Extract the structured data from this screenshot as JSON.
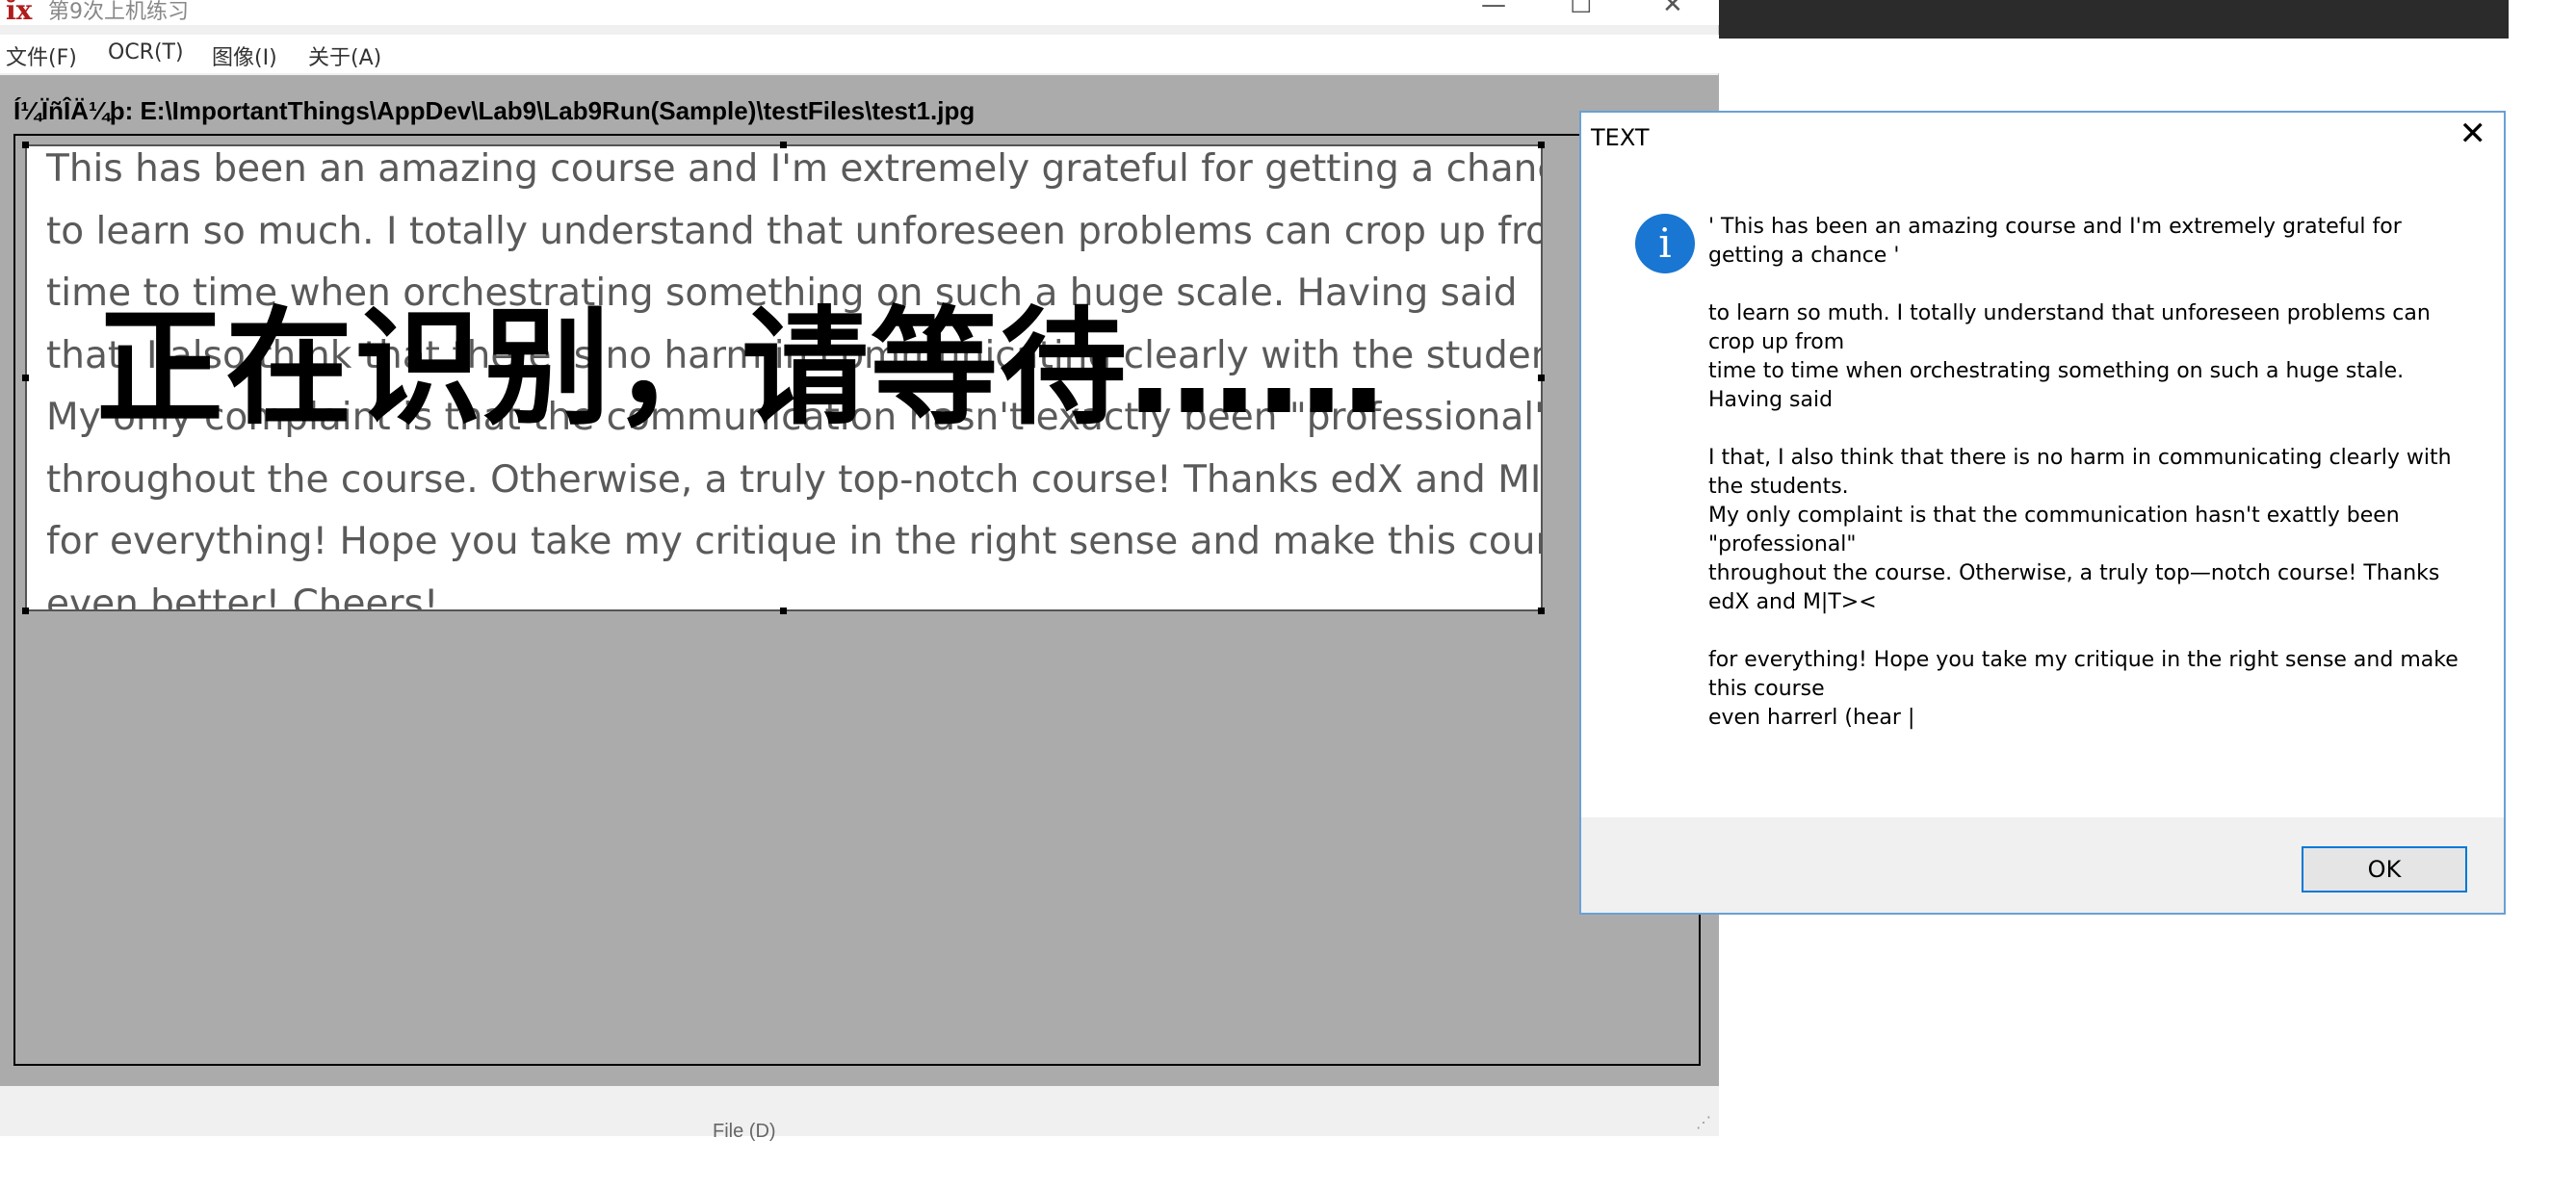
{
  "window": {
    "app_icon": "ĭx",
    "title": "第9次上机练习",
    "minimize": "—",
    "maximize": "☐",
    "close": "✕"
  },
  "menu": {
    "items": [
      "文件(F)",
      "OCR(T)",
      "图像(I)",
      "关于(A)"
    ]
  },
  "path_label": "Í¼ÏñÎÄ¼þ: E:\\ImportantThings\\AppDev\\Lab9\\Lab9Run(Sample)\\testFiles\\test1.jpg",
  "image_lines": [
    "This has been an amazing course and I'm extremely grateful for getting a chance",
    "to learn so much. I totally understand that unforeseen problems can crop up from",
    "time to time when orchestrating something on such a huge scale. Having said",
    "that, I also think that there is no harm in communicating clearly with the students.",
    "My only complaint is that the communication hasn't exactly been \"professional\"",
    "throughout the course. Otherwise, a truly top-notch course! Thanks edX and MITx",
    "for everything! Hope you take my critique in the right sense and make this course",
    "even better! Cheers!"
  ],
  "overlay_text": "正在识别，请等待……",
  "status_text": "File (D)",
  "dialog": {
    "title": "TEXT",
    "close": "✕",
    "icon": "info-icon",
    "lines": [
      "' This has been an amazing course and I'm extremely grateful for",
      "getting a chance '",
      "",
      "to learn so muth. I totally understand that unforeseen problems can",
      "crop up from",
      "time to time when orchestrating something on such a huge stale.",
      "Having said",
      "",
      "I that, I also think that there is no harm in communicating clearly with",
      "the students.",
      "My only complaint is that the communication hasn't exattly been",
      "\"professional\"",
      "throughout the course. Otherwise, a truly top—notch course! Thanks",
      "edX and M|T><",
      "",
      "for everything! Hope you take my critique in the right sense and make",
      "this course",
      "even harrerl (hear |"
    ],
    "ok_label": "OK"
  }
}
